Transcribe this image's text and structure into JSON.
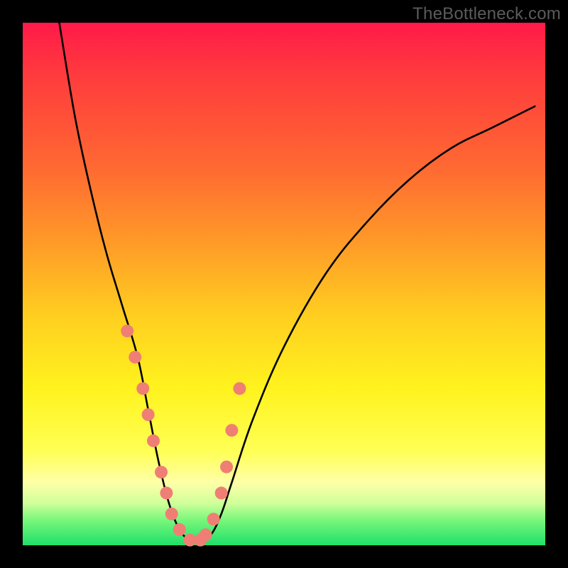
{
  "watermark": "TheBottleneck.com",
  "colors": {
    "frame_bg": "#000000",
    "curve": "#000000",
    "marker": "#ef7f74",
    "gradient_top": "#ff1a4a",
    "gradient_bottom": "#1ee06a"
  },
  "chart_data": {
    "type": "line",
    "title": "",
    "xlabel": "",
    "ylabel": "",
    "xlim": [
      0,
      100
    ],
    "ylim": [
      0,
      100
    ],
    "legend": false,
    "grid": false,
    "notes": "V-shaped bottleneck curve on rainbow gradient. y≈100 denotes severe bottleneck (red), y≈0 denotes no bottleneck (green). Trough near x≈28–36.",
    "series": [
      {
        "name": "vcurve",
        "x": [
          7,
          10,
          13,
          16,
          19,
          22,
          24,
          26,
          28,
          30,
          32,
          34,
          36,
          38,
          40,
          44,
          50,
          58,
          66,
          74,
          82,
          90,
          98
        ],
        "values": [
          100,
          82,
          68,
          56,
          46,
          36,
          26,
          16,
          8,
          3,
          1,
          1,
          2,
          6,
          12,
          24,
          38,
          52,
          62,
          70,
          76,
          80,
          84
        ]
      }
    ],
    "markers": {
      "name": "highlight-points",
      "x": [
        20,
        21.5,
        23,
        24,
        25,
        26.5,
        27.5,
        28.5,
        30,
        32,
        34,
        35,
        36.5,
        38,
        39,
        40,
        41.5
      ],
      "values": [
        41,
        36,
        30,
        25,
        20,
        14,
        10,
        6,
        3,
        1,
        1,
        2,
        5,
        10,
        15,
        22,
        30
      ]
    }
  }
}
